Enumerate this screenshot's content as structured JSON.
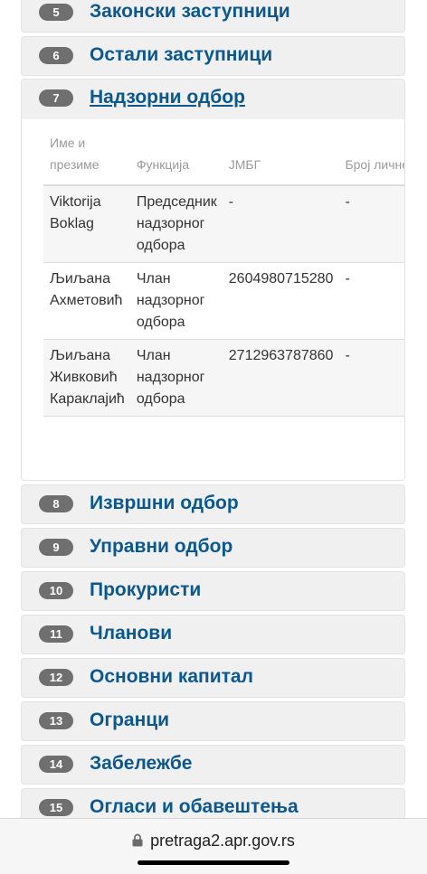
{
  "sections_top": [
    {
      "number": "5",
      "label": "Законски заступници"
    },
    {
      "number": "6",
      "label": "Остали заступници"
    }
  ],
  "expanded_section": {
    "number": "7",
    "label": "Надзорни одбор",
    "table": {
      "headers": [
        "Име и презиме",
        "Функција",
        "ЈМБГ",
        "Број личне карте странц"
      ],
      "rows": [
        {
          "name": "Viktorija Boklag",
          "function": "Председник надзорног одбора",
          "jmbg": "-",
          "card": "-"
        },
        {
          "name": "Љиљана Ахметовић",
          "function": "Члан надзорног одбора",
          "jmbg": "2604980715280",
          "card": "-"
        },
        {
          "name": "Љиљана Живковић Караклајић",
          "function": "Члан надзорног одбора",
          "jmbg": "2712963787860",
          "card": "-"
        }
      ]
    }
  },
  "sections_bottom": [
    {
      "number": "8",
      "label": "Извршни одбор"
    },
    {
      "number": "9",
      "label": "Управни одбор"
    },
    {
      "number": "10",
      "label": "Прокуристи"
    },
    {
      "number": "11",
      "label": "Чланови"
    },
    {
      "number": "12",
      "label": "Основни капитал"
    },
    {
      "number": "13",
      "label": "Огранци"
    },
    {
      "number": "14",
      "label": "Забележбе"
    },
    {
      "number": "15",
      "label": "Огласи и обавештења"
    }
  ],
  "browser": {
    "url": "pretraga2.apr.gov.rs",
    "lock_icon": "lock-icon"
  },
  "colors": {
    "link_blue": "#0b5891",
    "badge_gray": "#6f6f70",
    "section_bg": "#f0f0f1"
  }
}
